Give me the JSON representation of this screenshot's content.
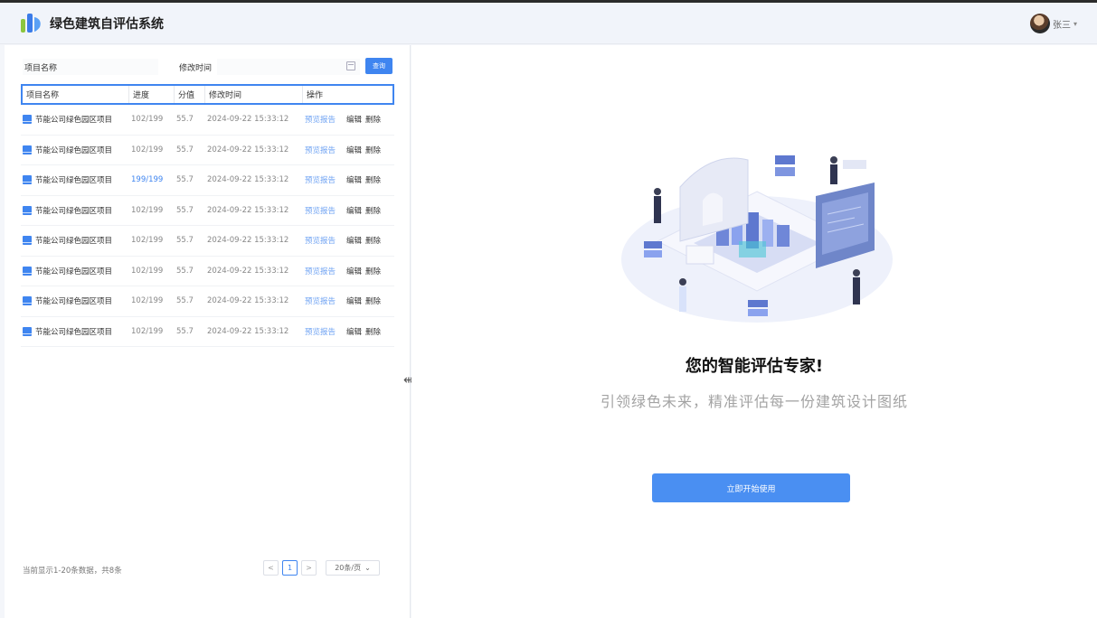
{
  "app": {
    "title": "绿色建筑自评估系统"
  },
  "user": {
    "name": "张三"
  },
  "filters": {
    "name_label": "项目名称",
    "time_label": "修改时间",
    "query_label": "查询"
  },
  "table": {
    "columns": [
      "项目名称",
      "进度",
      "分值",
      "修改时间",
      "操作"
    ],
    "rows": [
      {
        "name": "节能公司绿色园区项目",
        "progress": "102/199",
        "score": "55.7",
        "time": "2024-09-22 15:33:12"
      },
      {
        "name": "节能公司绿色园区项目",
        "progress": "102/199",
        "score": "55.7",
        "time": "2024-09-22 15:33:12"
      },
      {
        "name": "节能公司绿色园区项目",
        "progress": "199/199",
        "score": "55.7",
        "time": "2024-09-22 15:33:12"
      },
      {
        "name": "节能公司绿色园区项目",
        "progress": "102/199",
        "score": "55.7",
        "time": "2024-09-22 15:33:12"
      },
      {
        "name": "节能公司绿色园区项目",
        "progress": "102/199",
        "score": "55.7",
        "time": "2024-09-22 15:33:12"
      },
      {
        "name": "节能公司绿色园区项目",
        "progress": "102/199",
        "score": "55.7",
        "time": "2024-09-22 15:33:12"
      },
      {
        "name": "节能公司绿色园区项目",
        "progress": "102/199",
        "score": "55.7",
        "time": "2024-09-22 15:33:12"
      },
      {
        "name": "节能公司绿色园区项目",
        "progress": "102/199",
        "score": "55.7",
        "time": "2024-09-22 15:33:12"
      }
    ],
    "ops": {
      "preview": "预览报告",
      "edit": "编辑",
      "delete": "删除"
    }
  },
  "pagination": {
    "summary": "当前显示1-20条数据，共8条",
    "prev": "<",
    "current": "1",
    "next": ">",
    "page_size": "20条/页"
  },
  "hero": {
    "headline": "您的智能评估专家!",
    "subline": "引领绿色未来，精准评估每一份建筑设计图纸",
    "start_label": "立即开始使用"
  },
  "colors": {
    "accent": "#3f85f0",
    "button": "#4a8ff2"
  }
}
